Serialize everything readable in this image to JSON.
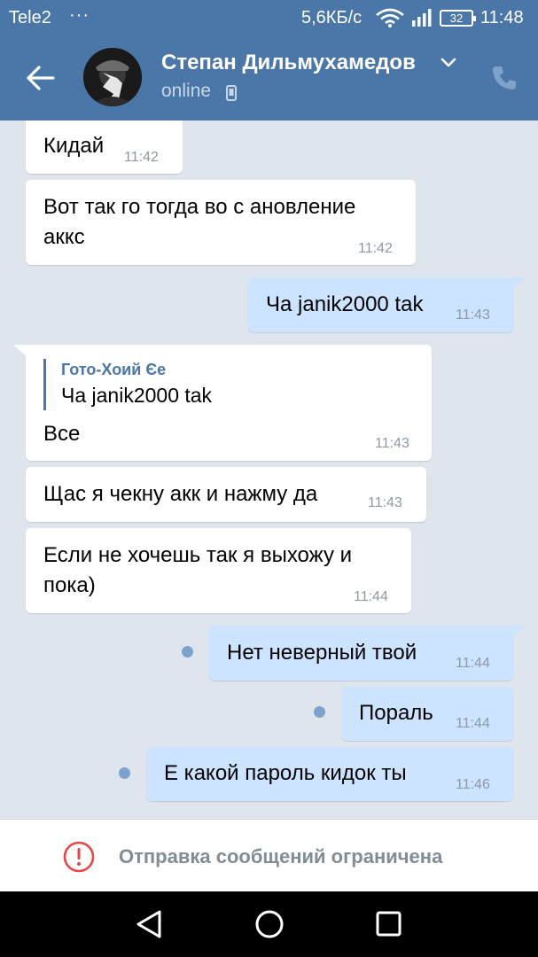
{
  "status_bar": {
    "carrier": "Tele2",
    "dots": "···",
    "speed": "5,6КБ/с",
    "battery": "32",
    "time": "11:48",
    "icons": [
      "wifi-icon",
      "signal-icon",
      "battery-icon"
    ]
  },
  "header": {
    "contact_name": "Степан Дильмухамедов",
    "status": "online",
    "icons": [
      "back-arrow-icon",
      "chevron-down-icon",
      "mobile-phone-icon",
      "call-icon"
    ]
  },
  "messages": [
    {
      "direction": "in",
      "text": "Кидай",
      "time": "11:42"
    },
    {
      "direction": "in",
      "lines": [
        "Вот так го тогда во с ановление",
        "аккс"
      ],
      "time": "11:42"
    },
    {
      "direction": "out",
      "text": "Ча janik2000 tak",
      "time": "11:43",
      "unread": false
    },
    {
      "direction": "in",
      "reply": {
        "author": "Гото-Хоий Єе",
        "text": "Ча janik2000 tak"
      },
      "text": "Все",
      "time": "11:43"
    },
    {
      "direction": "in",
      "text": "Щас я чекну акк и нажму да",
      "time": "11:43"
    },
    {
      "direction": "in",
      "lines": [
        "Если не хочешь так я выхожу и",
        "пока)"
      ],
      "time": "11:44"
    },
    {
      "direction": "out",
      "text": "Нет неверный твой",
      "time": "11:44",
      "unread": true
    },
    {
      "direction": "out",
      "text": "Пораль",
      "time": "11:44",
      "unread": true
    },
    {
      "direction": "out",
      "text": "Е какой пароль кидок ты",
      "time": "11:46",
      "unread": true
    }
  ],
  "footer": {
    "restriction_text": "Отправка сообщений ограничена",
    "icon": "alert-circle-icon"
  },
  "navbar": {
    "icons": [
      "nav-back-icon",
      "nav-home-icon",
      "nav-recent-apps-icon"
    ]
  },
  "colors": {
    "header": "#4a76a8",
    "chat_background": "#dfe5ec",
    "incoming_bubble": "#ffffff",
    "outgoing_bubble": "#cce4ff",
    "alert": "#e64646"
  }
}
